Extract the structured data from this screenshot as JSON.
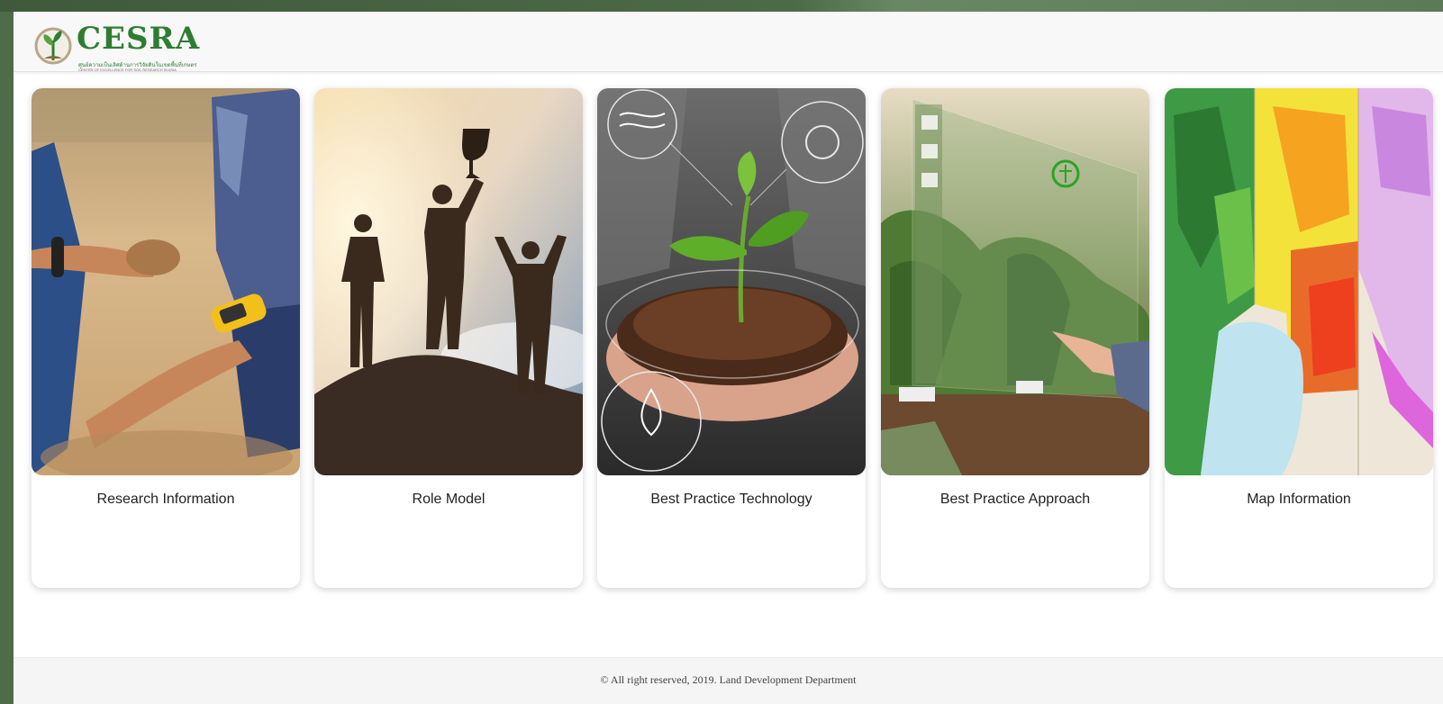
{
  "brand": {
    "name": "CESRA",
    "subtitle": "ศูนย์ความเป็นเลิศด้านการวิจัยดินในเขตพื้นที่เกษตร",
    "subtitle_en": "CENTER OF EXCELLENCE FOR SOIL RESEARCH IN ASIA",
    "logo_icon": "plant-logo-icon"
  },
  "cards": [
    {
      "label": "Research Information",
      "image": "soil-research-photo"
    },
    {
      "label": "Role Model",
      "image": "silhouette-trophy-photo"
    },
    {
      "label": "Best Practice Technology",
      "image": "seedling-hands-photo"
    },
    {
      "label": "Best Practice Approach",
      "image": "smart-farm-photo"
    },
    {
      "label": "Map Information",
      "image": "land-use-map"
    }
  ],
  "footer": {
    "copyright": "© All right reserved, 2019. Land Development Department"
  },
  "colors": {
    "brand_green": "#2e7d32",
    "outer_frame": "#4f6b4a"
  }
}
